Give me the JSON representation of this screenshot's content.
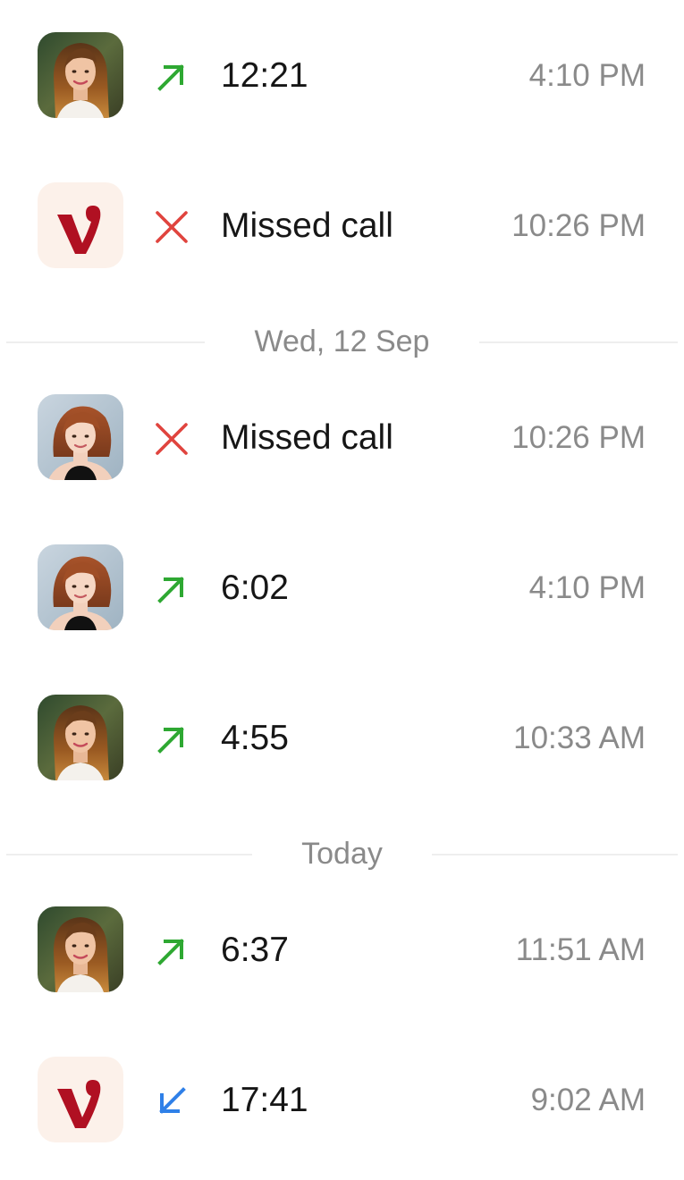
{
  "colors": {
    "outgoing": "#2ea832",
    "missed": "#e0443e",
    "incoming": "#2f80e8",
    "label": "#161616",
    "time": "#8a8a8a",
    "divider": "#eeeeee",
    "brand_bg": "#fcf1ea",
    "brand_mark": "#b01022"
  },
  "calls": [
    {
      "avatar": "woman-long-hair-avatar",
      "direction": "outgoing",
      "icon": "outgoing-call-arrow-icon",
      "label": "12:21",
      "time": "4:10 PM"
    },
    {
      "avatar": "brand-v-logo-avatar",
      "direction": "missed",
      "icon": "missed-call-x-icon",
      "label": "Missed call",
      "time": "10:26 PM"
    },
    {
      "avatar": "woman-bob-hair-avatar",
      "direction": "missed",
      "icon": "missed-call-x-icon",
      "label": "Missed call",
      "time": "10:26 PM"
    },
    {
      "avatar": "woman-bob-hair-avatar",
      "direction": "outgoing",
      "icon": "outgoing-call-arrow-icon",
      "label": "6:02",
      "time": "4:10 PM"
    },
    {
      "avatar": "woman-long-hair-avatar",
      "direction": "outgoing",
      "icon": "outgoing-call-arrow-icon",
      "label": "4:55",
      "time": "10:33 AM"
    },
    {
      "avatar": "woman-long-hair-avatar",
      "direction": "outgoing",
      "icon": "outgoing-call-arrow-icon",
      "label": "6:37",
      "time": "11:51 AM"
    },
    {
      "avatar": "brand-v-logo-avatar",
      "direction": "incoming",
      "icon": "incoming-call-arrow-icon",
      "label": "17:41",
      "time": "9:02 AM"
    }
  ],
  "dividers": [
    {
      "label": "Wed, 12 Sep"
    },
    {
      "label": "Today"
    }
  ]
}
